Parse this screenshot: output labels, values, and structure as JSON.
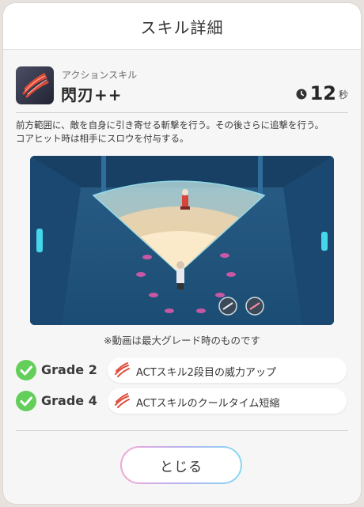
{
  "dialog": {
    "title": "スキル詳細"
  },
  "skill": {
    "type": "アクションスキル",
    "name": "閃刃++",
    "cooldown_value": "12",
    "cooldown_unit": "秒",
    "description_line1": "前方範囲に、敵を自身に引き寄せる斬撃を行う。その後さらに追撃を行う。",
    "description_line2": "コアヒット時は相手にスロウを付与する。",
    "icon": "slash-skill-icon"
  },
  "video": {
    "note": "※動画は最大グレード時のものです"
  },
  "grades": [
    {
      "label": "Grade 2",
      "effect": "ACTスキル2段目の威力アップ"
    },
    {
      "label": "Grade 4",
      "effect": "ACTスキルのクールタイム短縮"
    }
  ],
  "footer": {
    "close_label": "とじる"
  },
  "colors": {
    "check": "#63cf5a",
    "accent_gradient": [
      "#f3a6d4",
      "#b8b2f0",
      "#88d8f2"
    ],
    "skill_red": "#e04a38"
  }
}
